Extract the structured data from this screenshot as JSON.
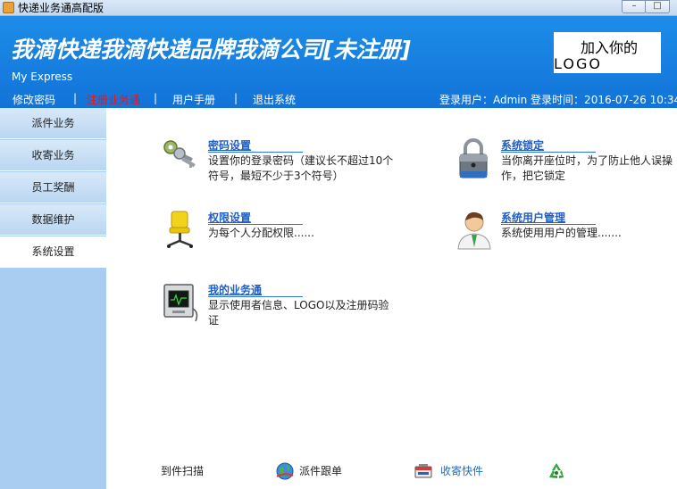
{
  "window": {
    "title": "快递业务通高配版",
    "minimize_glyph": "–",
    "maximize_glyph": "□"
  },
  "header": {
    "brand": "我滴快递我滴快递品牌我滴公司[未注册]",
    "subtitle": "My Express",
    "logo_line1": "加入你的",
    "logo_line2": "LOGO",
    "menu": [
      {
        "label": "修改密码"
      },
      {
        "label": "注册业务通",
        "active": true
      },
      {
        "label": "用户手册"
      },
      {
        "label": "退出系统"
      }
    ],
    "separator": "|",
    "login_info": "登录用户：Admin  登录时间：2016-07-26 10:34"
  },
  "sidebar": {
    "items": [
      {
        "label": "派件业务"
      },
      {
        "label": "收寄业务"
      },
      {
        "label": "员工奖酬"
      },
      {
        "label": "数据维护"
      },
      {
        "label": "系统设置",
        "selected": true
      }
    ]
  },
  "features": [
    {
      "title": "密码设置",
      "desc": "设置你的登录密码（建议长不超过10个符号，最短不少于3个符号）",
      "icon": "keys-icon"
    },
    {
      "title": "系统锁定",
      "desc": "当你离开座位时，为了防止他人误操作，把它锁定",
      "icon": "padlock-icon"
    },
    {
      "title": "权限设置",
      "desc": "为每个人分配权限......",
      "icon": "chair-icon"
    },
    {
      "title": "系统用户管理",
      "desc": "系统使用用户的管理.......",
      "icon": "user-icon"
    },
    {
      "title": "我的业务通",
      "desc": "显示使用者信息、LOGO以及注册码验证",
      "icon": "monitor-icon"
    }
  ],
  "bottom": [
    {
      "label": "到件扫描",
      "icon": ""
    },
    {
      "label": "派件跟单",
      "icon": "globe-icon"
    },
    {
      "label": "收寄快件",
      "icon": "package-icon"
    },
    {
      "label": "",
      "icon": "recycle-icon"
    }
  ],
  "colors": {
    "header_blue": "#1273d8",
    "sidebar_blue": "#a9cdf0",
    "link_blue": "#1f5fc4",
    "active_red": "#e8161c"
  }
}
